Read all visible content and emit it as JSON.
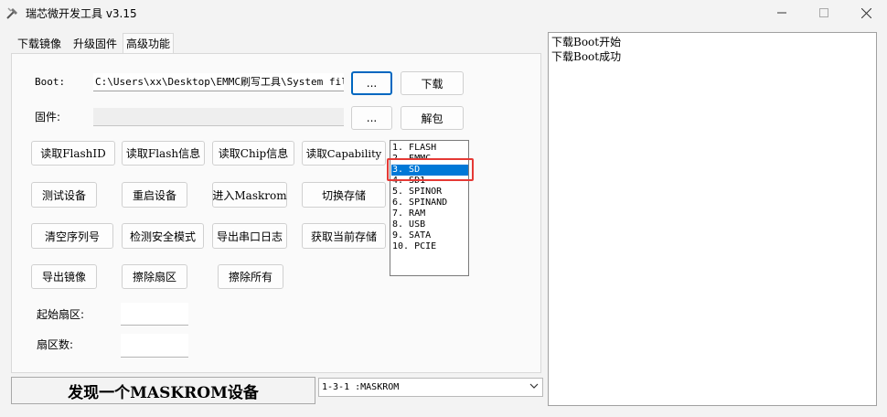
{
  "window": {
    "title": "瑞芯微开发工具 v3.15"
  },
  "tabs": [
    {
      "label": "下载镜像"
    },
    {
      "label": "升级固件"
    },
    {
      "label": "高级功能"
    }
  ],
  "boot": {
    "label": "Boot:",
    "path_value": "C:\\Users\\xx\\Desktop\\EMMC刷写工具\\System files",
    "browse_label": "...",
    "download_label": "下载"
  },
  "firmware": {
    "label": "固件:",
    "path_value": "",
    "browse_label": "...",
    "unpack_label": "解包"
  },
  "buttons": {
    "read_flashid": "读取FlashID",
    "read_flash_info": "读取Flash信息",
    "read_chip_info": "读取Chip信息",
    "read_capability": "读取Capability",
    "test_device": "测试设备",
    "reset_device": "重启设备",
    "enter_maskrom": "进入Maskrom",
    "switch_storage": "切换存储",
    "clear_serial": "清空序列号",
    "detect_secure_mode": "检测安全模式",
    "export_serial_log": "导出串口日志",
    "get_current_storage": "获取当前存储",
    "export_image": "导出镜像",
    "erase_sector": "擦除扇区",
    "erase_all": "擦除所有"
  },
  "storage_list": {
    "items": [
      "1. FLASH",
      "2. EMMC",
      "3. SD",
      "4. SD1",
      "5. SPINOR",
      "6. SPINAND",
      "7. RAM",
      "8. USB",
      "9. SATA",
      "10. PCIE"
    ],
    "selected_index": 2
  },
  "sector": {
    "start_label": "起始扇区:",
    "start_value": "",
    "count_label": "扇区数:",
    "count_value": ""
  },
  "status": {
    "text": "发现一个MASKROM设备"
  },
  "device_select": {
    "value": "1-3-1 :MASKROM"
  },
  "log": {
    "lines": [
      "下载Boot开始",
      "下载Boot成功"
    ]
  },
  "colors": {
    "selection": "#0078d7",
    "highlight_box": "#e53935",
    "focus_border": "#0067c0"
  }
}
